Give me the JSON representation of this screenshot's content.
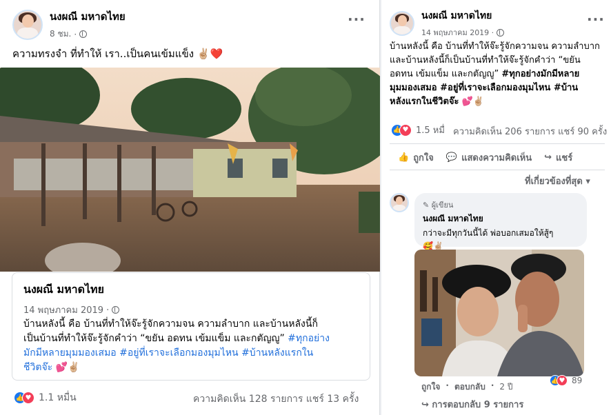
{
  "left_post": {
    "author": "นงผณี มหาดไทย",
    "time": "8 ชม.",
    "caption": "ความทรงจำ  ที่ทำให้ เรา..เป็นคนเข้มแข็ง",
    "caption_emoji": "✌🏼❤️",
    "shared": {
      "author": "นงผณี มหาดไทย",
      "date": "14 พฤษภาคม 2019 ·",
      "line1": "บ้านหลังนี้ คือ บ้านที่ทำให้จ๊ะรู้จักความจน ความลำบาก และบ้านหลังนี้ก็",
      "line2_plain": "เป็นบ้านที่ทำให้จ๊ะรู้จักคำว่า “ขยัน อดทน เข้มแข็ม และกตัญญู” ",
      "line2_link": "#ทุกอย่าง",
      "line3_link": "มักมีหลายมุมมองเสมอ #อยู่ที่เราจะเลือกมองมุมไหน #บ้านหลังแรกใน",
      "line4_link": "ชีวิตจ๊ะ",
      "line4_emoji": "💕✌🏼"
    },
    "reaction_count": "1.1 หมื่น",
    "comment_share": "ความคิดเห็น 128 รายการ  แชร์ 13 ครั้ง"
  },
  "right_post": {
    "author": "นงผณี มหาดไทย",
    "date": "14 พฤษภาคม 2019 ·",
    "caption_l1": "บ้านหลังนี้ คือ บ้านที่ทำให้จ๊ะรู้จักความจน ความลำบาก",
    "caption_l2": "และบ้านหลังนี้ก็เป็นบ้านที่ทำให้จ๊ะรู้จักคำว่า “ขยัน",
    "caption_l3_plain": "อดทน เข้มแข็ม และกตัญญู” ",
    "caption_l3_bold": "#ทุกอย่างมักมีหลาย",
    "caption_l4_bold": "มุมมองเสมอ #อยู่ที่เราจะเลือกมองมุมไหน #บ้าน",
    "caption_l5_bold": "หลังแรกในชีวิตจ๊ะ",
    "caption_emoji": "💕✌🏼",
    "reaction_count": "1.5 หมื่",
    "comment_share": "ความคิดเห็น 206 รายการ  แชร์ 90 ครั้ง",
    "like_label": "ถูกใจ",
    "comment_label": "แสดงความคิดเห็น",
    "share_label": "แชร์",
    "sort_label": "ที่เกี่ยวข้องที่สุด ▾",
    "comment": {
      "badge": "ผู้เขียน",
      "author": "นงผณี มหาดไทย",
      "text": "กว่าจะมีทุกวันนี้ได้ พ่อบอกเสมอให้สู้ๆ",
      "emoji": "🥰✌🏼",
      "like": "ถูกใจ",
      "reply": "ตอบกลับ",
      "age": "2 ปี",
      "reaction_count": "89"
    },
    "replies": "↪ การตอบกลับ 9 รายการ"
  }
}
